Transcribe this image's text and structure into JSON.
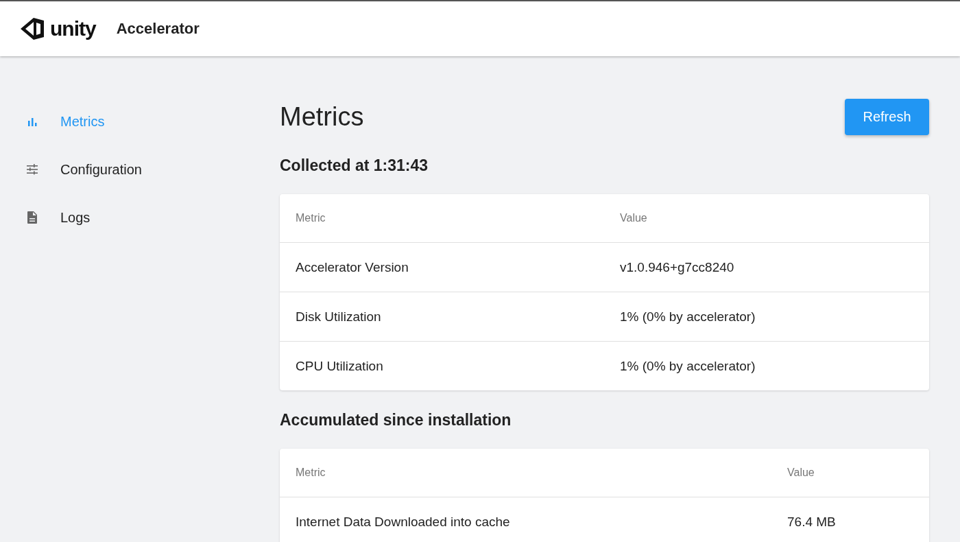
{
  "header": {
    "logo_text": "unity",
    "title": "Accelerator"
  },
  "sidebar": {
    "items": [
      {
        "kind": "chart",
        "label": "Metrics",
        "selected": true
      },
      {
        "kind": "sliders",
        "label": "Configuration",
        "selected": false
      },
      {
        "kind": "document",
        "label": "Logs",
        "selected": false
      }
    ]
  },
  "page": {
    "title": "Metrics",
    "refresh_button": "Refresh"
  },
  "sections": [
    {
      "heading": "Collected at 1:31:43",
      "columns": [
        "Metric",
        "Value"
      ],
      "rows": [
        [
          "Accelerator Version",
          "v1.0.946+g7cc8240"
        ],
        [
          "Disk Utilization",
          "1% (0% by accelerator)"
        ],
        [
          "CPU Utilization",
          "1% (0% by accelerator)"
        ]
      ]
    },
    {
      "heading": "Accumulated since installation",
      "columns": [
        "Metric",
        "Value"
      ],
      "rows": [
        [
          "Internet Data Downloaded into cache",
          "76.4 MB"
        ]
      ]
    }
  ]
}
